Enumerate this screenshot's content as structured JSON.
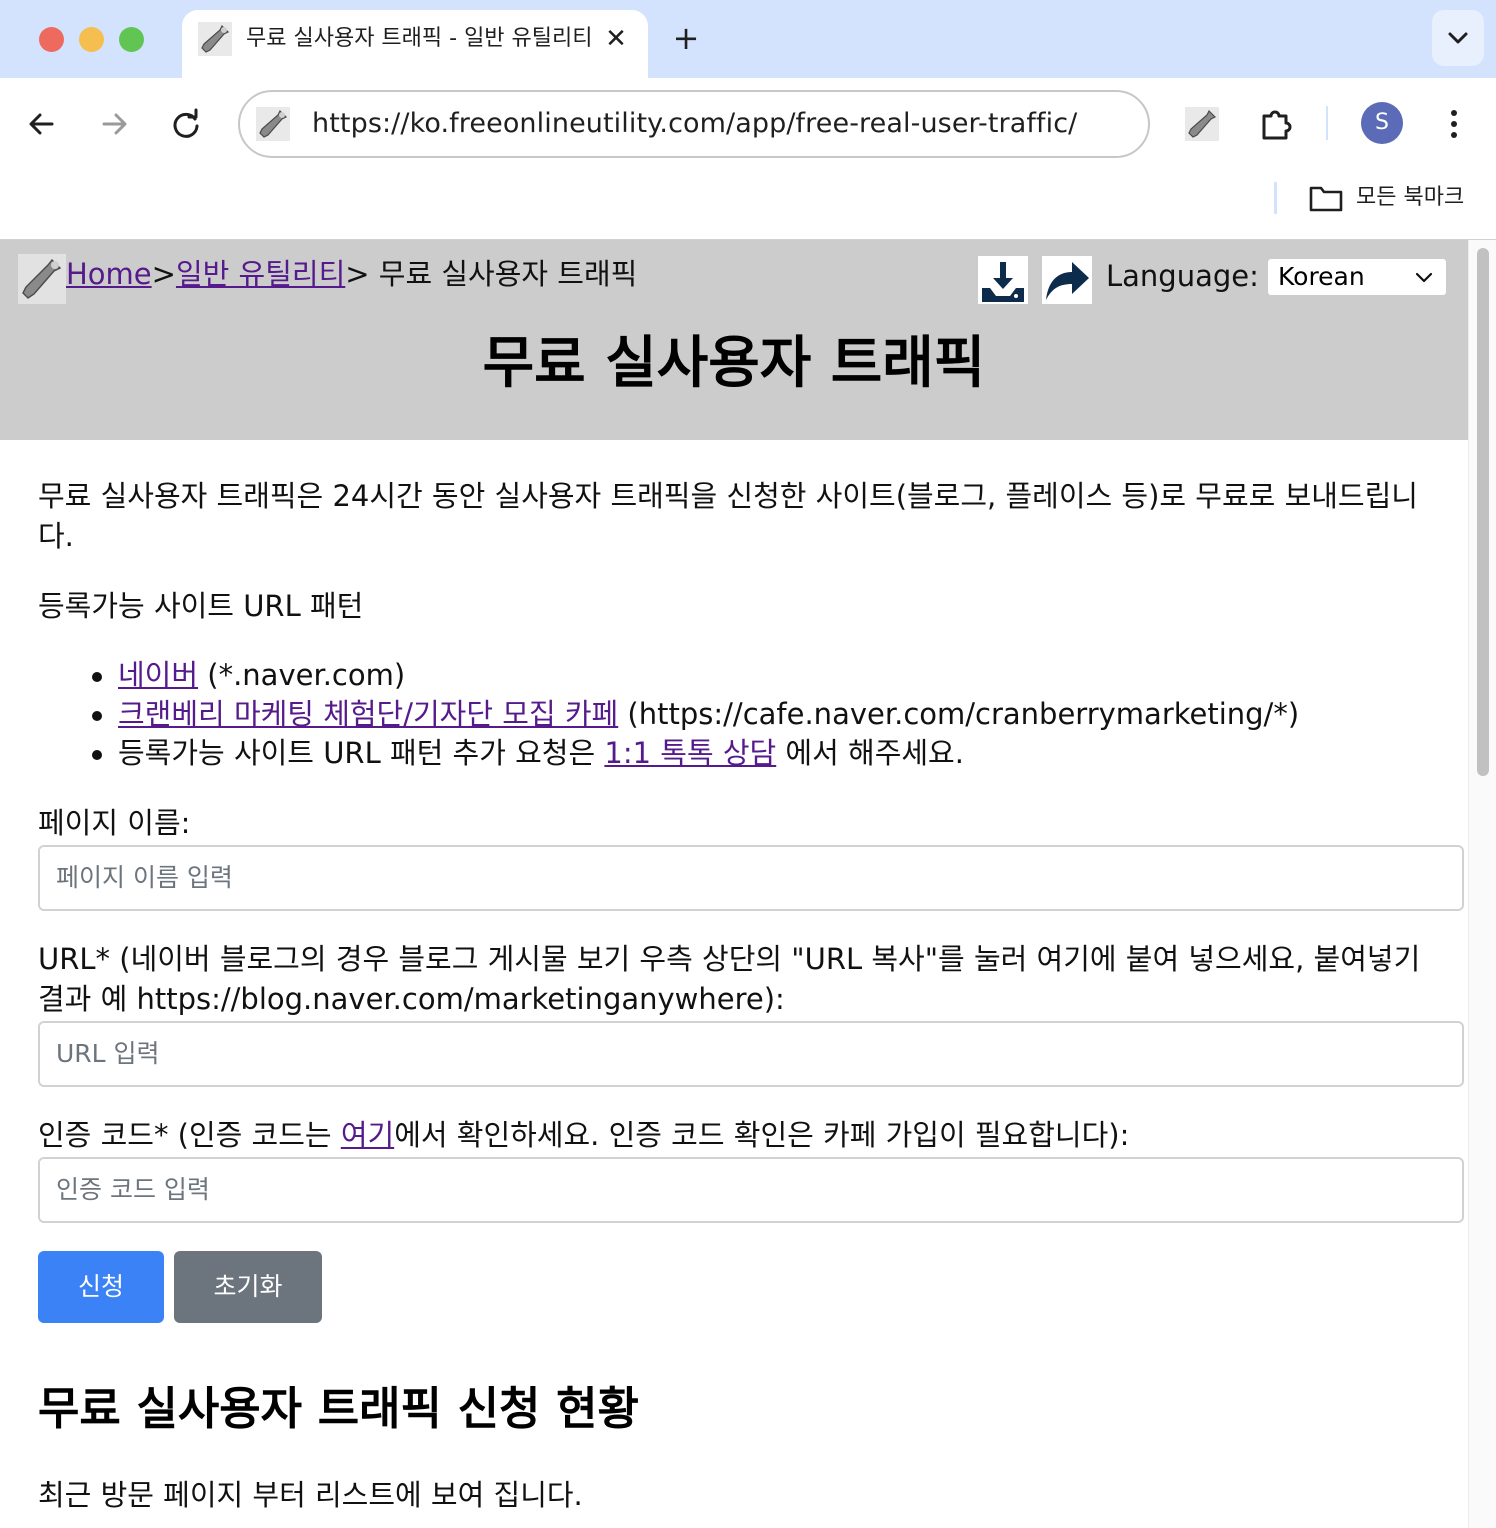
{
  "tab": {
    "title": "무료 실사용자 트래픽 - 일반 유틸리티",
    "close_glyph": "✕",
    "new_tab_glyph": "+"
  },
  "omnibox": {
    "url": "https://ko.freeonlineutility.com/app/free-real-user-traffic/"
  },
  "profile": {
    "initial": "S"
  },
  "bookmarks": {
    "label": "모든 북마크"
  },
  "breadcrumb": {
    "home": "Home",
    "sep1": ">",
    "category": "일반 유틸리티",
    "sep2": "> 무료 실사용자 트래픽"
  },
  "language": {
    "label": "Language:",
    "selected": "Korean"
  },
  "page": {
    "title": "무료 실사용자 트래픽",
    "intro": "무료 실사용자 트래픽은 24시간 동안 실사용자 트래픽을 신청한 사이트(블로그, 플레이스 등)로 무료로 보내드립니다.",
    "patterns_heading": "등록가능 사이트 URL 패턴",
    "patterns": {
      "naver_link": "네이버",
      "naver_text": " (*.naver.com)",
      "cafe_link": "크랜베리 마케팅 체험단/기자단 모집 카페",
      "cafe_text": " (https://cafe.naver.com/cranberrymarketing/*)",
      "request_text": "등록가능 사이트 URL 패턴 추가 요청은 ",
      "request_link": "1:1 톡톡 상담",
      "request_suffix": " 에서 해주세요."
    }
  },
  "form": {
    "page_name_label": "페이지 이름:",
    "page_name_placeholder": "페이지 이름 입력",
    "url_label": "URL* (네이버 블로그의 경우 블로그 게시물 보기 우측 상단의 \"URL 복사\"를 눌러 여기에 붙여 넣으세요, 붙여넣기 결과 예 https://blog.naver.com/marketinganywhere):",
    "url_placeholder": "URL 입력",
    "code_label_prefix": "인증 코드* (인증 코드는 ",
    "code_label_link": "여기",
    "code_label_suffix": "에서 확인하세요. 인증 코드 확인은 카페 가입이 필요합니다):",
    "code_placeholder": "인증 코드 입력",
    "submit": "신청",
    "reset": "초기화"
  },
  "status": {
    "heading": "무료 실사용자 트래픽 신청 현황",
    "note": "최근 방문 페이지 부터 리스트에 보여 집니다."
  },
  "colors": {
    "tabstrip": "#d3e3fd",
    "header_band": "#cccccc",
    "link_visited": "#551a8b",
    "primary": "#3b82f6",
    "secondary": "#6c757d",
    "avatar": "#5b6bb7"
  },
  "icons": [
    "wrench-favicon-icon",
    "back-arrow-icon",
    "forward-arrow-icon",
    "reload-icon",
    "extensions-puzzle-icon",
    "more-vert-icon",
    "folder-icon",
    "download-icon",
    "share-arrow-icon",
    "chevron-down-icon",
    "tab-search-icon"
  ]
}
